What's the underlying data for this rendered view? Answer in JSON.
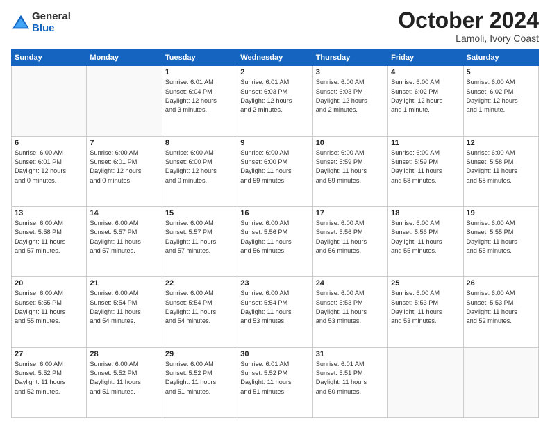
{
  "logo": {
    "general": "General",
    "blue": "Blue"
  },
  "header": {
    "month": "October 2024",
    "location": "Lamoli, Ivory Coast"
  },
  "weekdays": [
    "Sunday",
    "Monday",
    "Tuesday",
    "Wednesday",
    "Thursday",
    "Friday",
    "Saturday"
  ],
  "weeks": [
    [
      {
        "day": "",
        "info": ""
      },
      {
        "day": "",
        "info": ""
      },
      {
        "day": "1",
        "info": "Sunrise: 6:01 AM\nSunset: 6:04 PM\nDaylight: 12 hours\nand 3 minutes."
      },
      {
        "day": "2",
        "info": "Sunrise: 6:01 AM\nSunset: 6:03 PM\nDaylight: 12 hours\nand 2 minutes."
      },
      {
        "day": "3",
        "info": "Sunrise: 6:00 AM\nSunset: 6:03 PM\nDaylight: 12 hours\nand 2 minutes."
      },
      {
        "day": "4",
        "info": "Sunrise: 6:00 AM\nSunset: 6:02 PM\nDaylight: 12 hours\nand 1 minute."
      },
      {
        "day": "5",
        "info": "Sunrise: 6:00 AM\nSunset: 6:02 PM\nDaylight: 12 hours\nand 1 minute."
      }
    ],
    [
      {
        "day": "6",
        "info": "Sunrise: 6:00 AM\nSunset: 6:01 PM\nDaylight: 12 hours\nand 0 minutes."
      },
      {
        "day": "7",
        "info": "Sunrise: 6:00 AM\nSunset: 6:01 PM\nDaylight: 12 hours\nand 0 minutes."
      },
      {
        "day": "8",
        "info": "Sunrise: 6:00 AM\nSunset: 6:00 PM\nDaylight: 12 hours\nand 0 minutes."
      },
      {
        "day": "9",
        "info": "Sunrise: 6:00 AM\nSunset: 6:00 PM\nDaylight: 11 hours\nand 59 minutes."
      },
      {
        "day": "10",
        "info": "Sunrise: 6:00 AM\nSunset: 5:59 PM\nDaylight: 11 hours\nand 59 minutes."
      },
      {
        "day": "11",
        "info": "Sunrise: 6:00 AM\nSunset: 5:59 PM\nDaylight: 11 hours\nand 58 minutes."
      },
      {
        "day": "12",
        "info": "Sunrise: 6:00 AM\nSunset: 5:58 PM\nDaylight: 11 hours\nand 58 minutes."
      }
    ],
    [
      {
        "day": "13",
        "info": "Sunrise: 6:00 AM\nSunset: 5:58 PM\nDaylight: 11 hours\nand 57 minutes."
      },
      {
        "day": "14",
        "info": "Sunrise: 6:00 AM\nSunset: 5:57 PM\nDaylight: 11 hours\nand 57 minutes."
      },
      {
        "day": "15",
        "info": "Sunrise: 6:00 AM\nSunset: 5:57 PM\nDaylight: 11 hours\nand 57 minutes."
      },
      {
        "day": "16",
        "info": "Sunrise: 6:00 AM\nSunset: 5:56 PM\nDaylight: 11 hours\nand 56 minutes."
      },
      {
        "day": "17",
        "info": "Sunrise: 6:00 AM\nSunset: 5:56 PM\nDaylight: 11 hours\nand 56 minutes."
      },
      {
        "day": "18",
        "info": "Sunrise: 6:00 AM\nSunset: 5:56 PM\nDaylight: 11 hours\nand 55 minutes."
      },
      {
        "day": "19",
        "info": "Sunrise: 6:00 AM\nSunset: 5:55 PM\nDaylight: 11 hours\nand 55 minutes."
      }
    ],
    [
      {
        "day": "20",
        "info": "Sunrise: 6:00 AM\nSunset: 5:55 PM\nDaylight: 11 hours\nand 55 minutes."
      },
      {
        "day": "21",
        "info": "Sunrise: 6:00 AM\nSunset: 5:54 PM\nDaylight: 11 hours\nand 54 minutes."
      },
      {
        "day": "22",
        "info": "Sunrise: 6:00 AM\nSunset: 5:54 PM\nDaylight: 11 hours\nand 54 minutes."
      },
      {
        "day": "23",
        "info": "Sunrise: 6:00 AM\nSunset: 5:54 PM\nDaylight: 11 hours\nand 53 minutes."
      },
      {
        "day": "24",
        "info": "Sunrise: 6:00 AM\nSunset: 5:53 PM\nDaylight: 11 hours\nand 53 minutes."
      },
      {
        "day": "25",
        "info": "Sunrise: 6:00 AM\nSunset: 5:53 PM\nDaylight: 11 hours\nand 53 minutes."
      },
      {
        "day": "26",
        "info": "Sunrise: 6:00 AM\nSunset: 5:53 PM\nDaylight: 11 hours\nand 52 minutes."
      }
    ],
    [
      {
        "day": "27",
        "info": "Sunrise: 6:00 AM\nSunset: 5:52 PM\nDaylight: 11 hours\nand 52 minutes."
      },
      {
        "day": "28",
        "info": "Sunrise: 6:00 AM\nSunset: 5:52 PM\nDaylight: 11 hours\nand 51 minutes."
      },
      {
        "day": "29",
        "info": "Sunrise: 6:00 AM\nSunset: 5:52 PM\nDaylight: 11 hours\nand 51 minutes."
      },
      {
        "day": "30",
        "info": "Sunrise: 6:01 AM\nSunset: 5:52 PM\nDaylight: 11 hours\nand 51 minutes."
      },
      {
        "day": "31",
        "info": "Sunrise: 6:01 AM\nSunset: 5:51 PM\nDaylight: 11 hours\nand 50 minutes."
      },
      {
        "day": "",
        "info": ""
      },
      {
        "day": "",
        "info": ""
      }
    ]
  ]
}
